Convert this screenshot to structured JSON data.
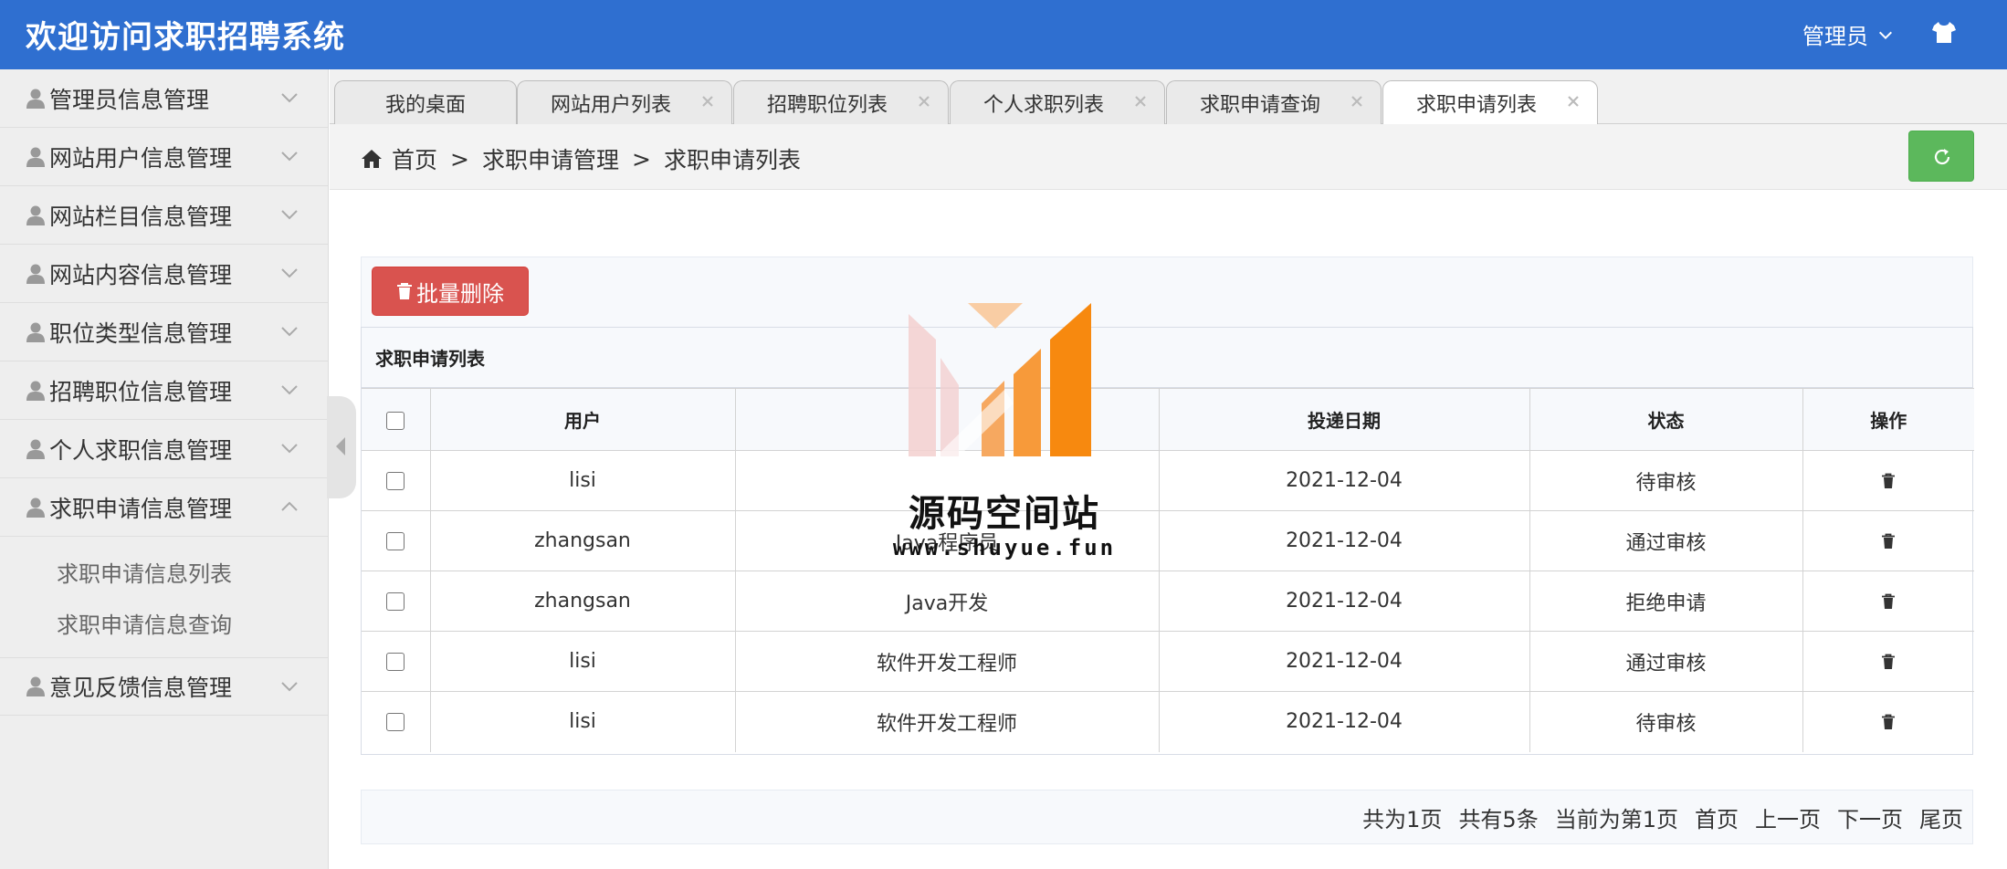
{
  "header": {
    "title": "欢迎访问求职招聘系统",
    "user_label": "管理员"
  },
  "sidebar": {
    "items": [
      {
        "label": "管理员信息管理"
      },
      {
        "label": "网站用户信息管理"
      },
      {
        "label": "网站栏目信息管理"
      },
      {
        "label": "网站内容信息管理"
      },
      {
        "label": "职位类型信息管理"
      },
      {
        "label": "招聘职位信息管理"
      },
      {
        "label": "个人求职信息管理"
      },
      {
        "label": "求职申请信息管理"
      },
      {
        "label": "意见反馈信息管理"
      }
    ],
    "submenu": [
      "求职申请信息列表",
      "求职申请信息查询"
    ]
  },
  "tabs": [
    {
      "label": "我的桌面"
    },
    {
      "label": "网站用户列表"
    },
    {
      "label": "招聘职位列表"
    },
    {
      "label": "个人求职列表"
    },
    {
      "label": "求职申请查询"
    },
    {
      "label": "求职申请列表"
    }
  ],
  "breadcrumb": {
    "home": "首页",
    "level1": "求职申请管理",
    "level2": "求职申请列表",
    "sep": ">"
  },
  "toolbar": {
    "batch_delete_label": "批量删除"
  },
  "panel": {
    "title": "求职申请列表"
  },
  "table": {
    "headers": [
      "用户",
      "",
      "投递日期",
      "状态",
      "操作"
    ],
    "rows": [
      {
        "user": "lisi",
        "position": "",
        "date": "2021-12-04",
        "status": "待审核"
      },
      {
        "user": "zhangsan",
        "position": "Java程序员",
        "date": "2021-12-04",
        "status": "通过审核"
      },
      {
        "user": "zhangsan",
        "position": "Java开发",
        "date": "2021-12-04",
        "status": "拒绝申请"
      },
      {
        "user": "lisi",
        "position": "软件开发工程师",
        "date": "2021-12-04",
        "status": "通过审核"
      },
      {
        "user": "lisi",
        "position": "软件开发工程师",
        "date": "2021-12-04",
        "status": "待审核"
      }
    ]
  },
  "pager": {
    "total_pages": "共为1页",
    "total_items": "共有5条",
    "current": "当前为第1页",
    "first": "首页",
    "prev": "上一页",
    "next": "下一页",
    "last": "尾页"
  },
  "watermark": {
    "name": "源码空间站",
    "url": "www.shuyue.fun"
  },
  "colors": {
    "header_bg": "#2f6fd0",
    "danger": "#d9534f",
    "success": "#5cb85c",
    "sidebar_bg": "#eeeeee"
  },
  "icons": [
    "user-icon",
    "chevron-down-icon",
    "chevron-up-icon",
    "tshirt-icon",
    "home-icon",
    "refresh-icon",
    "trash-icon",
    "close-icon",
    "chevron-left-icon"
  ]
}
